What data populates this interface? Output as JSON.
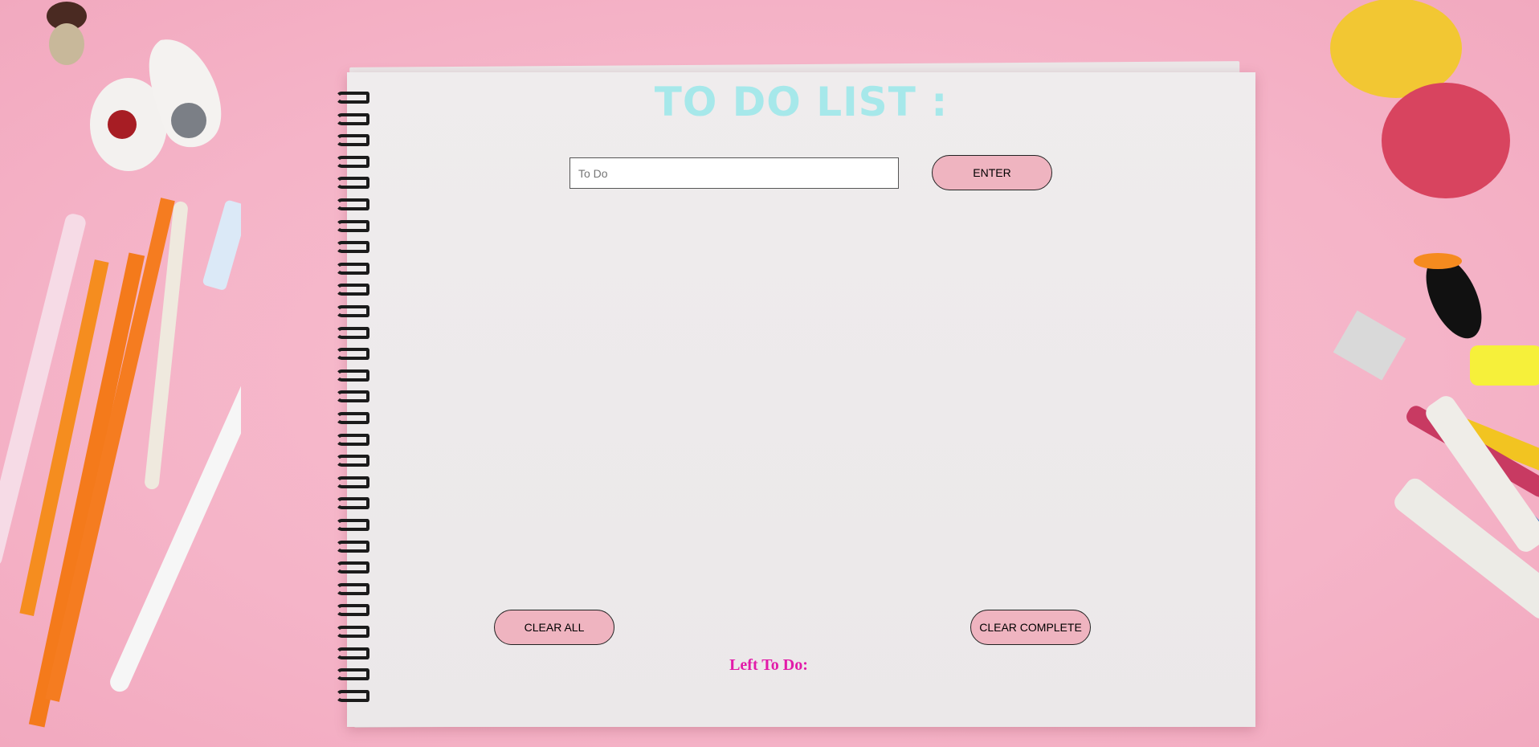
{
  "app": {
    "title": "TO DO LIST :",
    "input": {
      "placeholder": "To Do",
      "value": ""
    },
    "enter_label": "ENTER",
    "clear_all_label": "CLEAR ALL",
    "clear_complete_label": "CLEAR COMPLETE",
    "left_label": "Left To Do:",
    "todos": []
  },
  "colors": {
    "background": "#f5b4c8",
    "title": "#a6e8ea",
    "button": "#efb4c0",
    "left_label": "#e21ba9",
    "paper": "#eeebec"
  },
  "decorations": [
    "pencils-icon",
    "erasers-icon",
    "marker-pen-icon",
    "macarons-icon",
    "binder-clip-icon",
    "toucan-sticker-icon",
    "crayons-icon",
    "highlighter-icon"
  ]
}
